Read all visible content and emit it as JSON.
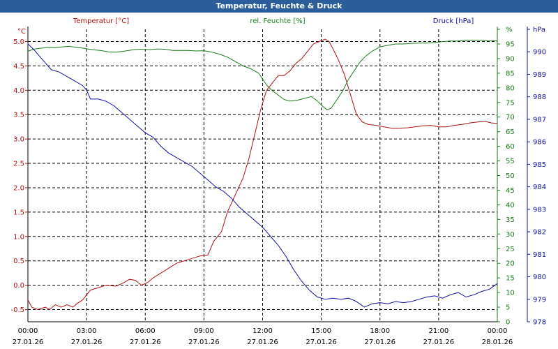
{
  "window": {
    "title": "Temperatur, Feuchte & Druck"
  },
  "chart_data": {
    "type": "line",
    "x_ticks": [
      {
        "time": "00:00",
        "date": "27.01.26"
      },
      {
        "time": "03:00",
        "date": "27.01.26"
      },
      {
        "time": "06:00",
        "date": "27.01.26"
      },
      {
        "time": "09:00",
        "date": "27.01.26"
      },
      {
        "time": "12:00",
        "date": "27.01.26"
      },
      {
        "time": "15:00",
        "date": "27.01.26"
      },
      {
        "time": "18:00",
        "date": "27.01.26"
      },
      {
        "time": "21:00",
        "date": "27.01.26"
      },
      {
        "time": "00:00",
        "date": "28.01.26"
      }
    ],
    "x_hours": [
      0,
      24
    ],
    "grid": true,
    "axes": {
      "temperature": {
        "unit": "°C",
        "min": -0.75,
        "max": 5.25,
        "ticks": [
          "-0.5",
          "0.0",
          "0.5",
          "1.0",
          "1.5",
          "2.0",
          "2.5",
          "3.0",
          "3.5",
          "4.0",
          "4.5",
          "5.0"
        ]
      },
      "humidity": {
        "unit": "%",
        "min": 0,
        "max": 100,
        "ticks": [
          "0",
          "5",
          "10",
          "15",
          "20",
          "25",
          "30",
          "35",
          "40",
          "45",
          "50",
          "55",
          "60",
          "65",
          "70",
          "75",
          "80",
          "85",
          "90",
          "95",
          "%"
        ]
      },
      "pressure": {
        "unit": "hPa",
        "min": 978,
        "max": 991,
        "ticks": [
          "978",
          "979",
          "980",
          "981",
          "982",
          "983",
          "984",
          "985",
          "986",
          "987",
          "988",
          "989",
          "990",
          "hPa"
        ]
      }
    },
    "series": [
      {
        "name": "Temperatur [°C]",
        "axis": "temperature",
        "color": "#b01010",
        "points": [
          [
            0,
            -0.3
          ],
          [
            0.2,
            -0.45
          ],
          [
            0.5,
            -0.5
          ],
          [
            0.9,
            -0.45
          ],
          [
            1.1,
            -0.5
          ],
          [
            1.4,
            -0.4
          ],
          [
            1.7,
            -0.45
          ],
          [
            2,
            -0.4
          ],
          [
            2.3,
            -0.45
          ],
          [
            2.5,
            -0.38
          ],
          [
            2.8,
            -0.3
          ],
          [
            3,
            -0.2
          ],
          [
            3.2,
            -0.1
          ],
          [
            3.6,
            -0.05
          ],
          [
            4,
            0.0
          ],
          [
            4.5,
            -0.02
          ],
          [
            4.9,
            0.05
          ],
          [
            5.2,
            0.12
          ],
          [
            5.5,
            0.1
          ],
          [
            5.8,
            0.0
          ],
          [
            6.1,
            0.05
          ],
          [
            6.4,
            0.15
          ],
          [
            6.8,
            0.25
          ],
          [
            7.2,
            0.35
          ],
          [
            7.6,
            0.45
          ],
          [
            8,
            0.5
          ],
          [
            8.4,
            0.55
          ],
          [
            8.8,
            0.6
          ],
          [
            9.2,
            0.62
          ],
          [
            9.5,
            0.9
          ],
          [
            9.9,
            1.1
          ],
          [
            10.2,
            1.5
          ],
          [
            10.6,
            1.85
          ],
          [
            11,
            2.2
          ],
          [
            11.3,
            2.6
          ],
          [
            11.6,
            3.1
          ],
          [
            11.9,
            3.6
          ],
          [
            12.2,
            4.0
          ],
          [
            12.5,
            4.15
          ],
          [
            12.8,
            4.3
          ],
          [
            13.1,
            4.3
          ],
          [
            13.4,
            4.4
          ],
          [
            13.7,
            4.55
          ],
          [
            14,
            4.65
          ],
          [
            14.3,
            4.8
          ],
          [
            14.6,
            4.95
          ],
          [
            14.9,
            5.0
          ],
          [
            15.2,
            5.05
          ],
          [
            15.4,
            5.0
          ],
          [
            15.6,
            4.85
          ],
          [
            15.9,
            4.6
          ],
          [
            16.2,
            4.3
          ],
          [
            16.5,
            3.9
          ],
          [
            16.8,
            3.5
          ],
          [
            17.1,
            3.35
          ],
          [
            17.4,
            3.3
          ],
          [
            17.8,
            3.28
          ],
          [
            18.2,
            3.25
          ],
          [
            18.6,
            3.22
          ],
          [
            19,
            3.22
          ],
          [
            19.4,
            3.23
          ],
          [
            19.8,
            3.25
          ],
          [
            20.2,
            3.27
          ],
          [
            20.6,
            3.28
          ],
          [
            21,
            3.25
          ],
          [
            21.4,
            3.25
          ],
          [
            21.8,
            3.28
          ],
          [
            22.2,
            3.3
          ],
          [
            22.6,
            3.33
          ],
          [
            23,
            3.35
          ],
          [
            23.4,
            3.36
          ],
          [
            23.7,
            3.33
          ],
          [
            24,
            3.32
          ]
        ]
      },
      {
        "name": "rel. Feuchte [%]",
        "axis": "humidity",
        "color": "#1a7a1a",
        "points": [
          [
            0,
            92.5
          ],
          [
            0.3,
            93.2
          ],
          [
            0.6,
            93.5
          ],
          [
            1,
            93.8
          ],
          [
            1.4,
            93.7
          ],
          [
            1.8,
            94
          ],
          [
            2.1,
            94.2
          ],
          [
            2.5,
            93.8
          ],
          [
            2.9,
            93.5
          ],
          [
            3.3,
            93
          ],
          [
            3.7,
            92.8
          ],
          [
            4.1,
            92.3
          ],
          [
            4.5,
            92.2
          ],
          [
            4.9,
            92.5
          ],
          [
            5.4,
            93
          ],
          [
            5.8,
            93.2
          ],
          [
            6.2,
            93
          ],
          [
            6.6,
            93.3
          ],
          [
            7,
            93.2
          ],
          [
            7.4,
            92.8
          ],
          [
            7.8,
            92.8
          ],
          [
            8.2,
            92.8
          ],
          [
            8.6,
            92.6
          ],
          [
            9,
            92.7
          ],
          [
            9.4,
            92.2
          ],
          [
            9.8,
            91.5
          ],
          [
            10.2,
            90.5
          ],
          [
            10.6,
            89
          ],
          [
            11,
            87.5
          ],
          [
            11.4,
            86.5
          ],
          [
            11.8,
            85
          ],
          [
            12.2,
            81
          ],
          [
            12.5,
            79
          ],
          [
            12.8,
            77.5
          ],
          [
            13.1,
            76
          ],
          [
            13.4,
            75.5
          ],
          [
            13.8,
            75.8
          ],
          [
            14.2,
            76.5
          ],
          [
            14.5,
            77
          ],
          [
            14.8,
            75.5
          ],
          [
            15.1,
            73.5
          ],
          [
            15.3,
            72.5
          ],
          [
            15.5,
            73
          ],
          [
            15.8,
            76
          ],
          [
            16.1,
            79
          ],
          [
            16.4,
            83
          ],
          [
            16.7,
            86
          ],
          [
            17,
            89
          ],
          [
            17.3,
            91
          ],
          [
            17.6,
            92.5
          ],
          [
            18,
            94
          ],
          [
            18.4,
            94.5
          ],
          [
            18.8,
            95
          ],
          [
            19.2,
            95
          ],
          [
            19.6,
            95.2
          ],
          [
            20,
            95.3
          ],
          [
            20.4,
            95.3
          ],
          [
            20.8,
            95.5
          ],
          [
            21.2,
            95.8
          ],
          [
            21.6,
            96
          ],
          [
            22,
            96
          ],
          [
            22.4,
            96.3
          ],
          [
            22.8,
            96.3
          ],
          [
            23.2,
            96.2
          ],
          [
            23.6,
            96
          ],
          [
            24,
            96.1
          ]
        ]
      },
      {
        "name": "Druck [hPa]",
        "axis": "pressure",
        "color": "#1010a0",
        "points": [
          [
            0,
            990.35
          ],
          [
            0.3,
            990.1
          ],
          [
            0.6,
            989.8
          ],
          [
            0.9,
            989.5
          ],
          [
            1.2,
            989.2
          ],
          [
            1.6,
            989.1
          ],
          [
            2,
            988.9
          ],
          [
            2.4,
            988.7
          ],
          [
            2.8,
            988.5
          ],
          [
            3,
            988.3
          ],
          [
            3.2,
            987.9
          ],
          [
            3.6,
            987.9
          ],
          [
            4,
            987.8
          ],
          [
            4.4,
            987.6
          ],
          [
            4.8,
            987.3
          ],
          [
            5.2,
            987.0
          ],
          [
            5.6,
            986.7
          ],
          [
            6,
            986.4
          ],
          [
            6.4,
            986.2
          ],
          [
            6.8,
            985.8
          ],
          [
            7.2,
            985.5
          ],
          [
            7.6,
            985.3
          ],
          [
            8,
            985.1
          ],
          [
            8.4,
            984.9
          ],
          [
            8.8,
            984.6
          ],
          [
            9.2,
            984.3
          ],
          [
            9.6,
            984.0
          ],
          [
            10,
            983.8
          ],
          [
            10.4,
            983.5
          ],
          [
            10.8,
            983.1
          ],
          [
            11.2,
            982.8
          ],
          [
            11.6,
            982.5
          ],
          [
            12,
            982.2
          ],
          [
            12.4,
            981.8
          ],
          [
            12.8,
            981.4
          ],
          [
            13.2,
            980.9
          ],
          [
            13.6,
            980.3
          ],
          [
            14,
            979.8
          ],
          [
            14.4,
            979.4
          ],
          [
            14.8,
            979.1
          ],
          [
            15.2,
            979.0
          ],
          [
            15.6,
            979.05
          ],
          [
            16,
            979.0
          ],
          [
            16.4,
            979.05
          ],
          [
            16.8,
            978.9
          ],
          [
            17.2,
            978.65
          ],
          [
            17.6,
            978.8
          ],
          [
            18,
            978.85
          ],
          [
            18.4,
            978.8
          ],
          [
            18.8,
            978.9
          ],
          [
            19.2,
            978.85
          ],
          [
            19.6,
            978.9
          ],
          [
            20,
            979.0
          ],
          [
            20.4,
            979.1
          ],
          [
            20.8,
            979.15
          ],
          [
            21.2,
            979.05
          ],
          [
            21.6,
            979.2
          ],
          [
            22,
            979.3
          ],
          [
            22.4,
            979.1
          ],
          [
            22.8,
            979.2
          ],
          [
            23.2,
            979.35
          ],
          [
            23.6,
            979.45
          ],
          [
            24,
            979.7
          ]
        ]
      }
    ]
  }
}
